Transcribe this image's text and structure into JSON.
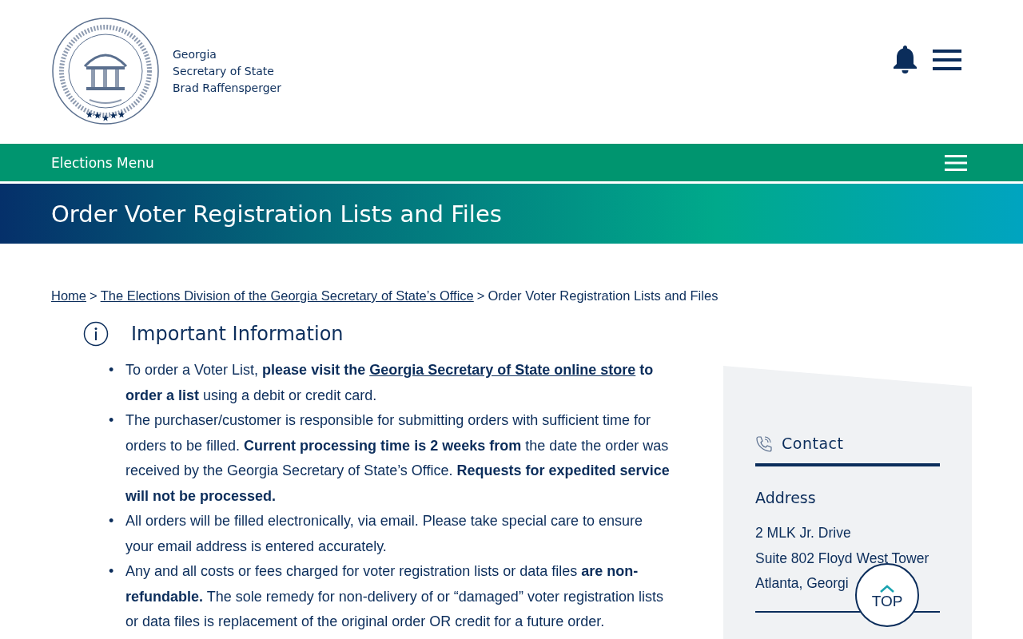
{
  "header": {
    "site_name_lines": [
      "Georgia",
      "Secretary of State",
      "Brad Raffensperger"
    ]
  },
  "section_bar": {
    "label": "Elections Menu"
  },
  "banner": {
    "title": "Order Voter Registration Lists and Files"
  },
  "breadcrumb": {
    "links": [
      "Home",
      "The Elections Division of the Georgia Secretary of State’s Office"
    ],
    "current": "Order Voter Registration Lists and Files",
    "separator": ">"
  },
  "important": {
    "heading": "Important Information",
    "marker": "•",
    "bullets": [
      [
        {
          "text": "To order a Voter List, **please visit the** "
        },
        {
          "link": "Georgia Secretary of State online store"
        },
        {
          "text": " **to order a list** using a debit or credit card."
        }
      ],
      [
        {
          "text": "The purchaser/customer is responsible for submitting orders with sufficient time for orders to be filled. **Current processing time is 2 weeks from** the date the order was received by the Georgia Secretary of State’s Office. **Requests for expedited service will not be processed.**"
        }
      ],
      [
        {
          "text": "All orders will be filled electronically, via email. Please take special care to ensure your email address is entered accurately."
        }
      ],
      [
        {
          "text": "Any and all costs or fees charged for voter registration lists or data files **are non-refundable.** The sole remedy for non-delivery of or “damaged” voter registration lists or data files is replacement of the original order OR credit for a future order."
        }
      ]
    ]
  },
  "contact": {
    "heading": "Contact",
    "address_label": "Address",
    "address_lines": [
      "2 MLK Jr. Drive",
      "Suite 802 Floyd West Tower",
      "Atlanta, Georgi"
    ]
  },
  "top_button": {
    "label": "TOP"
  }
}
